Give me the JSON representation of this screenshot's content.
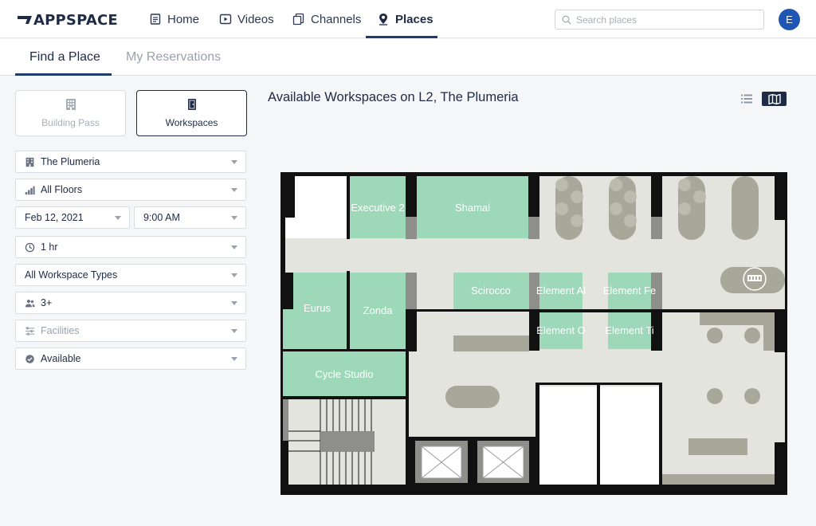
{
  "brand": {
    "logo_text": "APPSPACE"
  },
  "nav": {
    "items": [
      {
        "label": "Home",
        "icon": "document-icon"
      },
      {
        "label": "Videos",
        "icon": "video-icon"
      },
      {
        "label": "Channels",
        "icon": "channels-icon"
      },
      {
        "label": "Places",
        "icon": "location-pin-icon",
        "active": true
      }
    ],
    "search_placeholder": "Search places",
    "avatar_initial": "E"
  },
  "subtabs": [
    {
      "label": "Find a Place",
      "active": true
    },
    {
      "label": "My Reservations",
      "active": false
    }
  ],
  "modes": [
    {
      "label": "Building Pass",
      "icon": "building-icon",
      "active": false
    },
    {
      "label": "Workspaces",
      "icon": "door-icon",
      "active": true
    }
  ],
  "filters": {
    "building": "The Plumeria",
    "floor": "All Floors",
    "date": "Feb 12, 2021",
    "time": "9:00 AM",
    "duration": "1 hr",
    "workspace_type": "All Workspace Types",
    "capacity": "3+",
    "facilities": "Facilities",
    "availability": "Available"
  },
  "main": {
    "title": "Available Workspaces on L2, The Plumeria"
  },
  "floor_map": {
    "rooms": [
      "Executive 2",
      "Shamal",
      "Eurus",
      "Zonda",
      "Scirocco",
      "Element Al",
      "Element Fe",
      "Element O",
      "Element Ti",
      "Cycle Studio"
    ]
  },
  "colors": {
    "accent": "#1f3a6d",
    "available_room": "#9dd8b8",
    "floor": "#e4e4de",
    "furniture": "#a8a89a",
    "wall": "#111111",
    "avatar": "#1f55b3"
  }
}
